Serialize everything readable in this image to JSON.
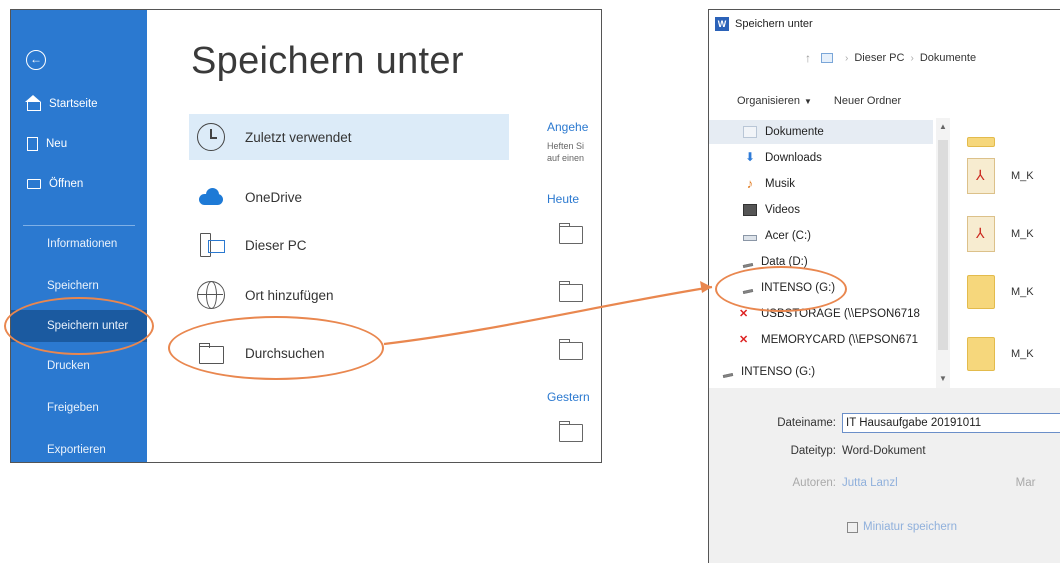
{
  "backstage": {
    "title": "Speichern unter",
    "back_icon": "arrow-left-circle-icon",
    "nav": {
      "home": "Startseite",
      "new": "Neu",
      "open": "Öffnen",
      "info": "Informationen",
      "save": "Speichern",
      "save_as": "Speichern unter",
      "print": "Drucken",
      "share": "Freigeben",
      "export": "Exportieren"
    },
    "locations": {
      "recent": "Zuletzt verwendet",
      "onedrive": "OneDrive",
      "this_pc": "Dieser PC",
      "add_place": "Ort hinzufügen",
      "browse": "Durchsuchen"
    },
    "recent_panel": {
      "pinned_head": "Angehe",
      "pinned_hint_1": "Heften Si",
      "pinned_hint_2": "auf einen",
      "today": "Heute",
      "yesterday": "Gestern"
    }
  },
  "dialog": {
    "title": "Speichern unter",
    "app_icon_letter": "W",
    "address": {
      "crumb_1": "Dieser PC",
      "crumb_2": "Dokumente"
    },
    "toolbar": {
      "organize": "Organisieren",
      "new_folder": "Neuer Ordner"
    },
    "tree": {
      "documents": "Dokumente",
      "downloads": "Downloads",
      "music": "Musik",
      "videos": "Videos",
      "acer": "Acer (C:)",
      "data": "Data (D:)",
      "intenso": "INTENSO (G:)",
      "usbstorage": "USBSTORAGE (\\\\EPSON6718",
      "memorycard": "MEMORYCARD (\\\\EPSON671",
      "intenso_2": "INTENSO (G:)"
    },
    "files": [
      "M_K",
      "M_K",
      "M_K",
      "M_K"
    ],
    "form": {
      "filename_label": "Dateiname:",
      "filename_value": "IT Hausaufgabe 20191011",
      "filetype_label": "Dateityp:",
      "filetype_value": "Word-Dokument",
      "authors_label": "Autoren:",
      "authors_value": "Jutta Lanzl",
      "tags_cut": "Mar",
      "thumbnail_label": "Miniatur speichern"
    }
  },
  "colors": {
    "accent_blue": "#2b79d0",
    "annotation_orange": "#e9874f"
  }
}
